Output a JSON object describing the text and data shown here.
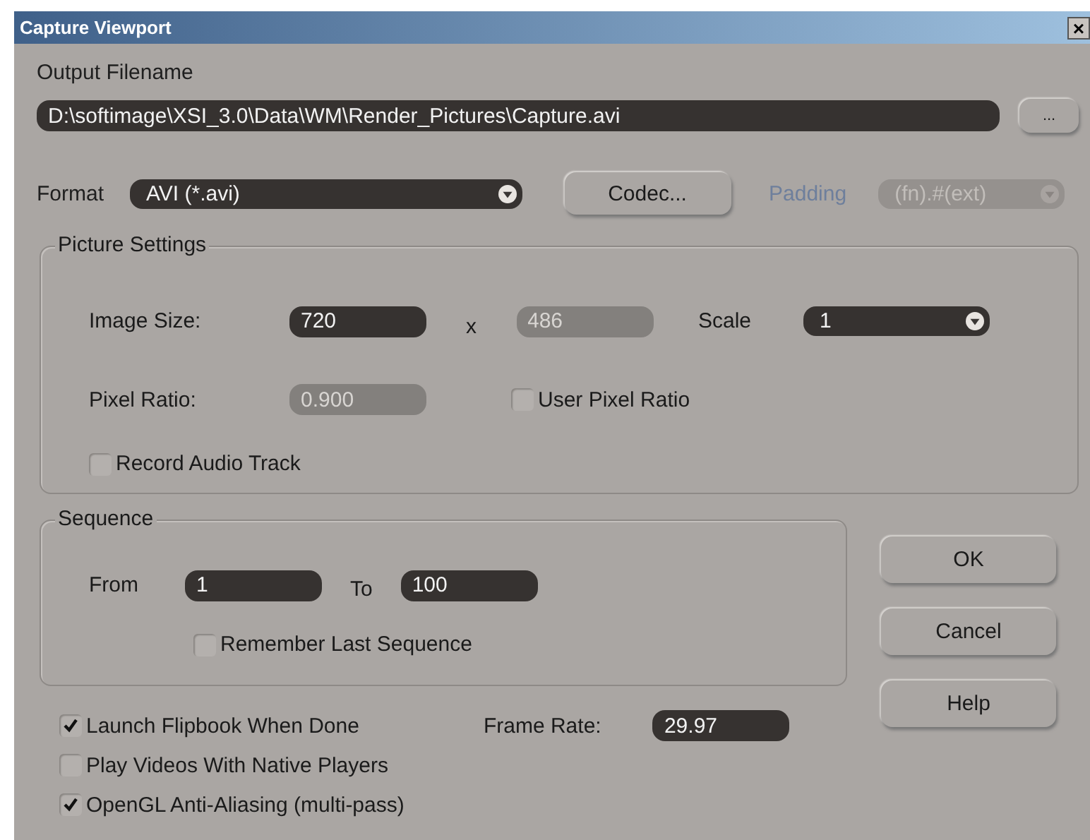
{
  "window": {
    "title": "Capture Viewport",
    "close": "×"
  },
  "output": {
    "label": "Output Filename",
    "value": "D:\\softimage\\XSI_3.0\\Data\\WM\\Render_Pictures\\Capture.avi",
    "browse": "..."
  },
  "format": {
    "label": "Format",
    "value": "AVI (*.avi)",
    "codec": "Codec...",
    "padding_label": "Padding",
    "padding_value": "(fn).#(ext)",
    "padding_disabled": true
  },
  "picture_settings": {
    "title": "Picture Settings",
    "image_size_label": "Image Size:",
    "width": {
      "value": "720",
      "disabled": false
    },
    "x": "x",
    "height": {
      "value": "486",
      "disabled": true
    },
    "scale_label": "Scale",
    "scale": "1",
    "pixel_ratio_label": "Pixel Ratio:",
    "pixel_ratio": {
      "value": "0.900",
      "disabled": true
    },
    "checkboxes": [
      {
        "label": "User Pixel Ratio",
        "checked": false
      },
      {
        "label": "Record Audio Track",
        "checked": false
      }
    ]
  },
  "sequence": {
    "title": "Sequence",
    "from_label": "From",
    "from": "1",
    "to_label": "To",
    "to": "100",
    "remember": {
      "label": "Remember Last Sequence",
      "checked": false
    }
  },
  "options": [
    {
      "label": "Launch Flipbook When Done",
      "checked": true
    },
    {
      "label": "Play Videos With Native Players",
      "checked": false
    },
    {
      "label": "OpenGL Anti-Aliasing (multi-pass)",
      "checked": true
    }
  ],
  "frame_rate": {
    "label": "Frame Rate:",
    "value": "29.97"
  },
  "buttons": [
    "OK",
    "Cancel",
    "Help"
  ]
}
